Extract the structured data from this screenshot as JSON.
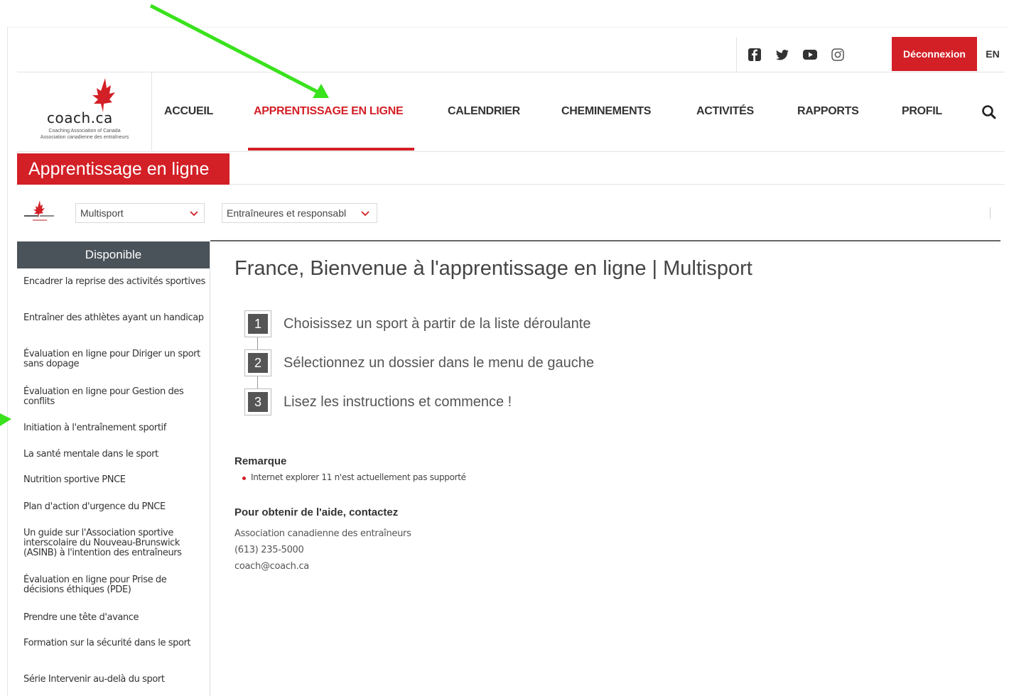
{
  "utility": {
    "social": [
      "facebook-icon",
      "twitter-icon",
      "youtube-icon",
      "instagram-icon"
    ],
    "logout_label": "Déconnexion",
    "language_label": "EN"
  },
  "logo": {
    "wordmark": "coach.ca",
    "subtitle_line1": "Coaching Association of Canada",
    "subtitle_line2": "Association canadienne des entraîneurs"
  },
  "nav": {
    "items": [
      "ACCUEIL",
      "APPRENTISSAGE EN LIGNE",
      "CALENDRIER",
      "CHEMINEMENTS",
      "ACTIVITÉS",
      "RAPPORTS",
      "PROFIL"
    ],
    "active": "APPRENTISSAGE EN LIGNE"
  },
  "section": {
    "title": "Apprentissage en ligne"
  },
  "filters": {
    "sport_selected": "Multisport",
    "audience_selected": "Entraîneures et responsabl"
  },
  "sidebar": {
    "heading": "Disponible",
    "items": [
      "Encadrer la reprise des activités sportives",
      "Entraîner des athlètes ayant un handicap",
      "Évaluation en ligne pour Diriger un sport sans dopage",
      "Évaluation en ligne pour Gestion des conflits",
      "Initiation à l'entraînement sportif",
      "La santé mentale dans le sport",
      "Nutrition sportive PNCE",
      "Plan d'action d'urgence du PNCE",
      "Un guide sur l'Association sportive interscolaire du Nouveau-Brunswick (ASINB) à l'intention des entraîneurs",
      "Évaluation en ligne pour Prise de décisions éthiques (PDE)",
      "Prendre une tête d'avance",
      "Formation sur la sécurité dans le sport",
      "Série Intervenir au-delà du sport"
    ]
  },
  "main": {
    "welcome": "France, Bienvenue à l'apprentissage en ligne | Multisport",
    "steps": [
      {
        "num": "1",
        "text": "Choisissez un sport à partir de la liste déroulante"
      },
      {
        "num": "2",
        "text": "Sélectionnez un dossier dans le menu de gauche"
      },
      {
        "num": "3",
        "text": "Lisez les instructions et commence !"
      }
    ],
    "note_title": "Remarque",
    "note_item": "Internet explorer 11 n'est actuellement pas supporté",
    "help_title": "Pour obtenir de l'aide, contactez",
    "help_org": "Association canadienne des entraîneurs",
    "help_phone": "(613) 235-5000",
    "help_email": "coach@coach.ca"
  },
  "colors": {
    "brand_red": "#d31f26",
    "sidebar_head": "#4a525a",
    "annotation_arrow": "#39e21c"
  }
}
